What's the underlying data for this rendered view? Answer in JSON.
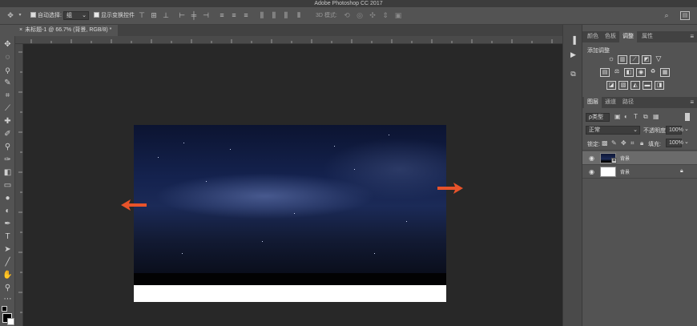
{
  "app": {
    "title": "Adobe Photoshop CC 2017"
  },
  "options_bar": {
    "auto_select_label": "自动选择:",
    "auto_select_value": "组",
    "show_transform_label": "显示变换控件",
    "mode_3d_label": "3D 模式:"
  },
  "document": {
    "tab_label": "未标题-1 @ 66.7% (背景, RGB/8) *"
  },
  "panels": {
    "top_tabs": [
      "颜色",
      "色板",
      "调整",
      "属性"
    ],
    "top_active": "调整",
    "adjust_title": "添加调整",
    "layer_tabs": [
      "图层",
      "通道",
      "路径"
    ],
    "layer_active": "图层",
    "filter_label": "ρ类型",
    "blend_mode": "正常",
    "opacity_label": "不透明度:",
    "opacity_value": "100%",
    "lock_label": "锁定:",
    "fill_label": "填充:",
    "fill_value": "100%",
    "layers": [
      {
        "name": "背景",
        "thumbnail": "night-sky",
        "locked": false,
        "selected": true
      },
      {
        "name": "背景",
        "thumbnail": "white",
        "locked": true,
        "selected": false
      }
    ]
  },
  "annotations": {
    "arrow_color": "#e8532a"
  }
}
